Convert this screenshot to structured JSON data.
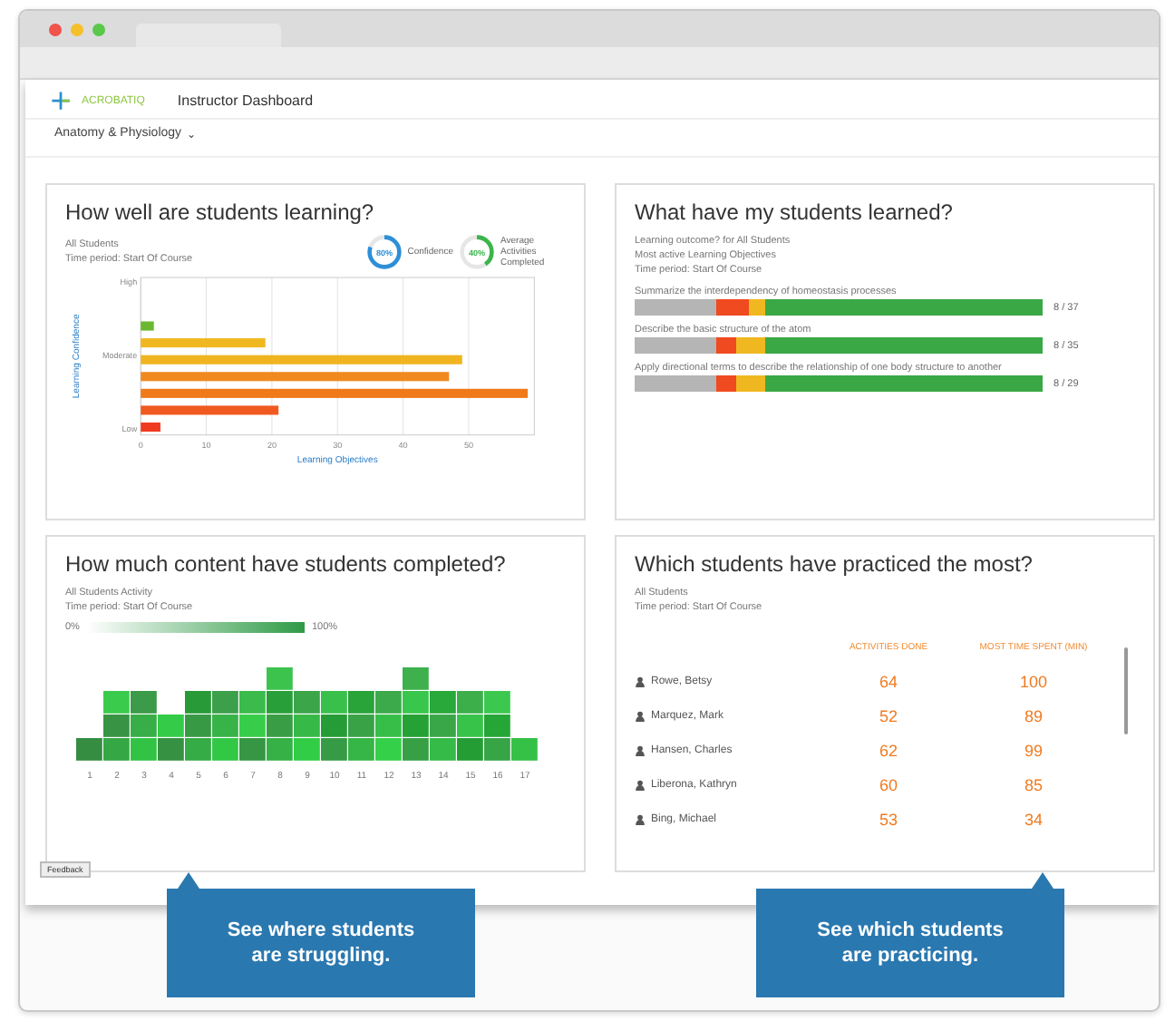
{
  "app": {
    "logo": "ACROBATIQ",
    "title": "Instructor Dashboard",
    "course": "Anatomy & Physiology",
    "course_caret": "⌄"
  },
  "learning": {
    "title": "How well are students learning?",
    "subtitle": [
      "All Students",
      "Time period: Start Of Course"
    ],
    "rings": [
      {
        "value": "80%",
        "label": "Confidence",
        "level": 0.8,
        "color": "#2d8fd8"
      },
      {
        "value": "40%",
        "label": "Average Activities Completed",
        "level": 0.4,
        "color": "#3bb54a"
      }
    ],
    "axes": {
      "xlabel": "Learning Objectives",
      "ylabel": "Learning Confidence",
      "xticks": [
        "0",
        "10",
        "20",
        "30",
        "40",
        "50"
      ],
      "ylevels": [
        "High",
        "Moderate",
        "Low"
      ]
    }
  },
  "learned": {
    "title": "What have my students learned?",
    "subtitle": [
      "Learning outcome? for All Students",
      "Most active Learning Objectives",
      "Time period: Start Of Course"
    ],
    "rows": [
      {
        "label": "Summarize the interdependency of homeostasis processes",
        "reading": "8 / 37"
      },
      {
        "label": "Describe the basic structure of the atom",
        "reading": "8 / 35"
      },
      {
        "label": "Apply directional terms to describe the relationship of one body structure to another",
        "reading": "8 / 29"
      }
    ]
  },
  "content": {
    "title": "How much content have students completed?",
    "subtitle": [
      "All Students Activity",
      "Time period: Start Of Course"
    ],
    "legend_min": "0%",
    "legend_max": "100%",
    "columns": [
      "1",
      "2",
      "3",
      "4",
      "5",
      "6",
      "7",
      "8",
      "9",
      "10",
      "11",
      "12",
      "13",
      "14",
      "15",
      "16",
      "17"
    ]
  },
  "practiced": {
    "title": "Which students have practiced the most?",
    "subtitle": [
      "All Students",
      "Time period: Start Of Course"
    ],
    "columns": [
      "ACTIVITIES DONE",
      "MOST TIME SPENT (MIN)"
    ],
    "rows": [
      {
        "name": "Rowe, Betsy",
        "activities": "64",
        "time": "100"
      },
      {
        "name": "Marquez, Mark",
        "activities": "52",
        "time": "89"
      },
      {
        "name": "Hansen, Charles",
        "activities": "62",
        "time": "99"
      },
      {
        "name": "Liberona, Kathryn",
        "activities": "60",
        "time": "85"
      },
      {
        "name": "Bing, Michael",
        "activities": "53",
        "time": "34"
      }
    ]
  },
  "feedback": "Feedback",
  "callouts": [
    "See where students are struggling.",
    "See which students are practicing."
  ]
}
